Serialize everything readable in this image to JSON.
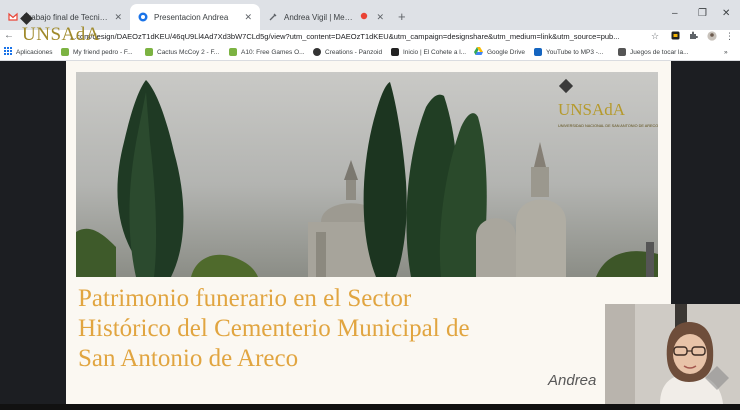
{
  "tabs": [
    {
      "title": "Trabajo final de Tecnicatura - Vig...",
      "favicon": "gmail-icon",
      "active": false
    },
    {
      "title": "Presentacion Andrea",
      "favicon": "canva-icon",
      "active": true
    },
    {
      "title": "Andrea Vigil | Meet UNSAdA",
      "favicon": "meet-icon",
      "active": false,
      "recording": true
    }
  ],
  "new_tab": "+",
  "window_controls": {
    "minimize": "–",
    "maximize": "❐",
    "close": "✕"
  },
  "address_bar": {
    "url": "...com/design/DAEOzT1dKEU/46qU9Ll4Ad7Xd3bW7CLd5g/view?utm_content=DAEOzT1dKEU&utm_campaign=designshare&utm_medium=link&utm_source=pub..."
  },
  "bookmarks": [
    {
      "label": "Aplicaciones",
      "icon": "apps-grid-icon"
    },
    {
      "label": "My friend pedro - F...",
      "icon": "game-icon"
    },
    {
      "label": "Cactus McCoy 2 - F...",
      "icon": "game-icon"
    },
    {
      "label": "A10: Free Games O...",
      "icon": "game-icon"
    },
    {
      "label": "Creations - Panzoid",
      "icon": "panzoid-icon"
    },
    {
      "label": "Inicio | El Cohete a l...",
      "icon": "site-icon"
    },
    {
      "label": "Google Drive",
      "icon": "drive-icon"
    },
    {
      "label": "YouTube to MP3 -...",
      "icon": "converter-icon"
    },
    {
      "label": "Juegos de tocar la...",
      "icon": "site-icon"
    }
  ],
  "overlay_logo": "UNSAdA",
  "slide": {
    "logo_name": "UNSAdA",
    "logo_sub": "UNIVERSIDAD NACIONAL DE SAN ANTONIO DE ARECO",
    "title_lines": [
      "Patrimonio funerario en el Sector",
      "Histórico del Cementerio Municipal de",
      "San Antonio de Areco"
    ],
    "author": "Andrea"
  },
  "colors": {
    "title": "#e1a540",
    "logo_gold": "#b59a2c",
    "slide_bg": "#fbf8f2",
    "recording": "#ea4335"
  }
}
